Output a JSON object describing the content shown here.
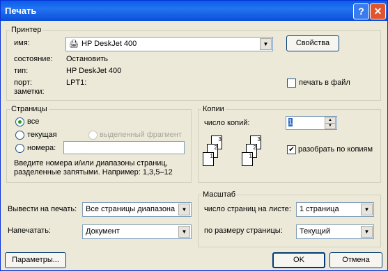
{
  "window": {
    "title": "Печать",
    "help_button": "?",
    "close_button": "✕"
  },
  "printer": {
    "legend": "Принтер",
    "name_label": "имя:",
    "name_value": "HP DeskJet 400",
    "properties_button": "Свойства",
    "status_label": "состояние:",
    "status_value": "Остановить",
    "type_label": "тип:",
    "type_value": "HP DeskJet 400",
    "port_label": "порт:",
    "port_value": "LPT1:",
    "notes_label": "заметки:",
    "print_to_file_label": "печать в файл",
    "print_to_file_checked": false
  },
  "pages": {
    "legend": "Страницы",
    "all_label": "все",
    "current_label": "текущая",
    "selection_label": "выделенный фрагмент",
    "numbers_label": "номера:",
    "numbers_value": "",
    "hint_line1": "Введите номера и/или диапазоны страниц,",
    "hint_line2": "разделенные запятыми. Например: 1,3,5–12",
    "selected": "all"
  },
  "copies": {
    "legend": "Копии",
    "count_label": "число копий:",
    "count_value": "1",
    "collate_label": "разобрать по копиям",
    "collate_checked": true,
    "page_numbers": [
      "1",
      "2",
      "3"
    ]
  },
  "output": {
    "print_what_label": "Вывести на печать:",
    "print_what_value": "Все страницы диапазона",
    "print_label": "Напечатать:",
    "print_value": "Документ"
  },
  "scale": {
    "legend": "Масштаб",
    "pages_per_sheet_label": "число страниц на листе:",
    "pages_per_sheet_value": "1 страница",
    "fit_label": "по размеру страницы:",
    "fit_value": "Текущий"
  },
  "footer": {
    "options_button": "Параметры...",
    "ok_button": "OK",
    "cancel_button": "Отмена"
  }
}
